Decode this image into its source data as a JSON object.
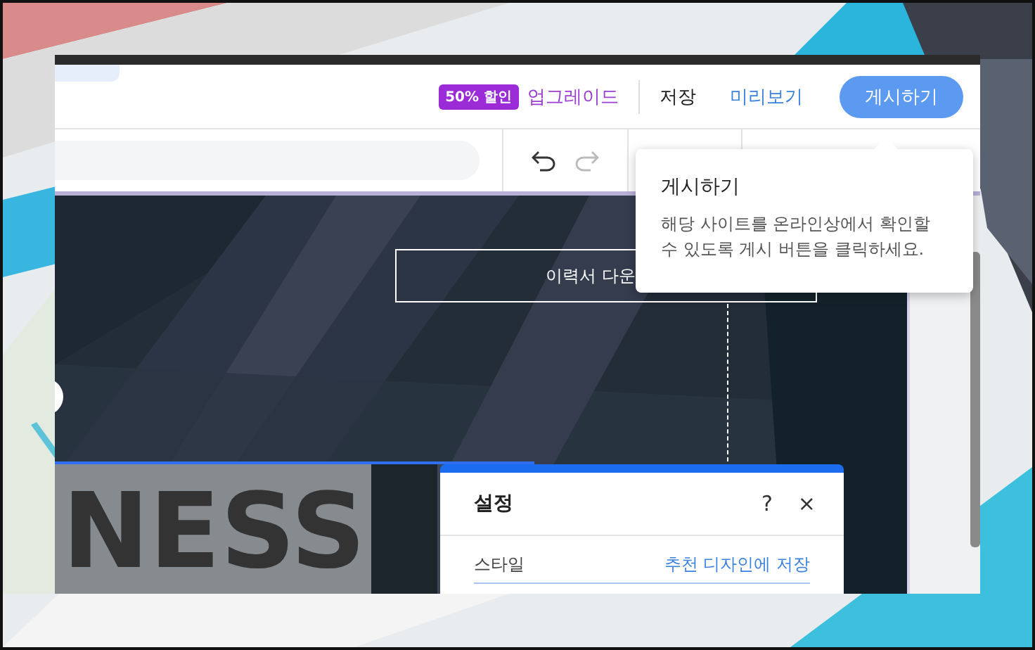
{
  "header": {
    "discount_badge": "50% 할인",
    "upgrade_link": "업그레이드",
    "save_button": "저장",
    "preview_button": "미리보기",
    "publish_button": "게시하기"
  },
  "tooltip": {
    "title": "게시하기",
    "text": "해당 사이트를 온라인상에서 확인할 수 있도록 게시 버튼을 클릭하세요."
  },
  "canvas": {
    "download_button": "이력서 다운",
    "headline": "NESS"
  },
  "settings_panel": {
    "title": "설정",
    "help": "?",
    "close": "×",
    "style_label": "스타일",
    "save_design_link": "추천 디자인에 저장"
  }
}
